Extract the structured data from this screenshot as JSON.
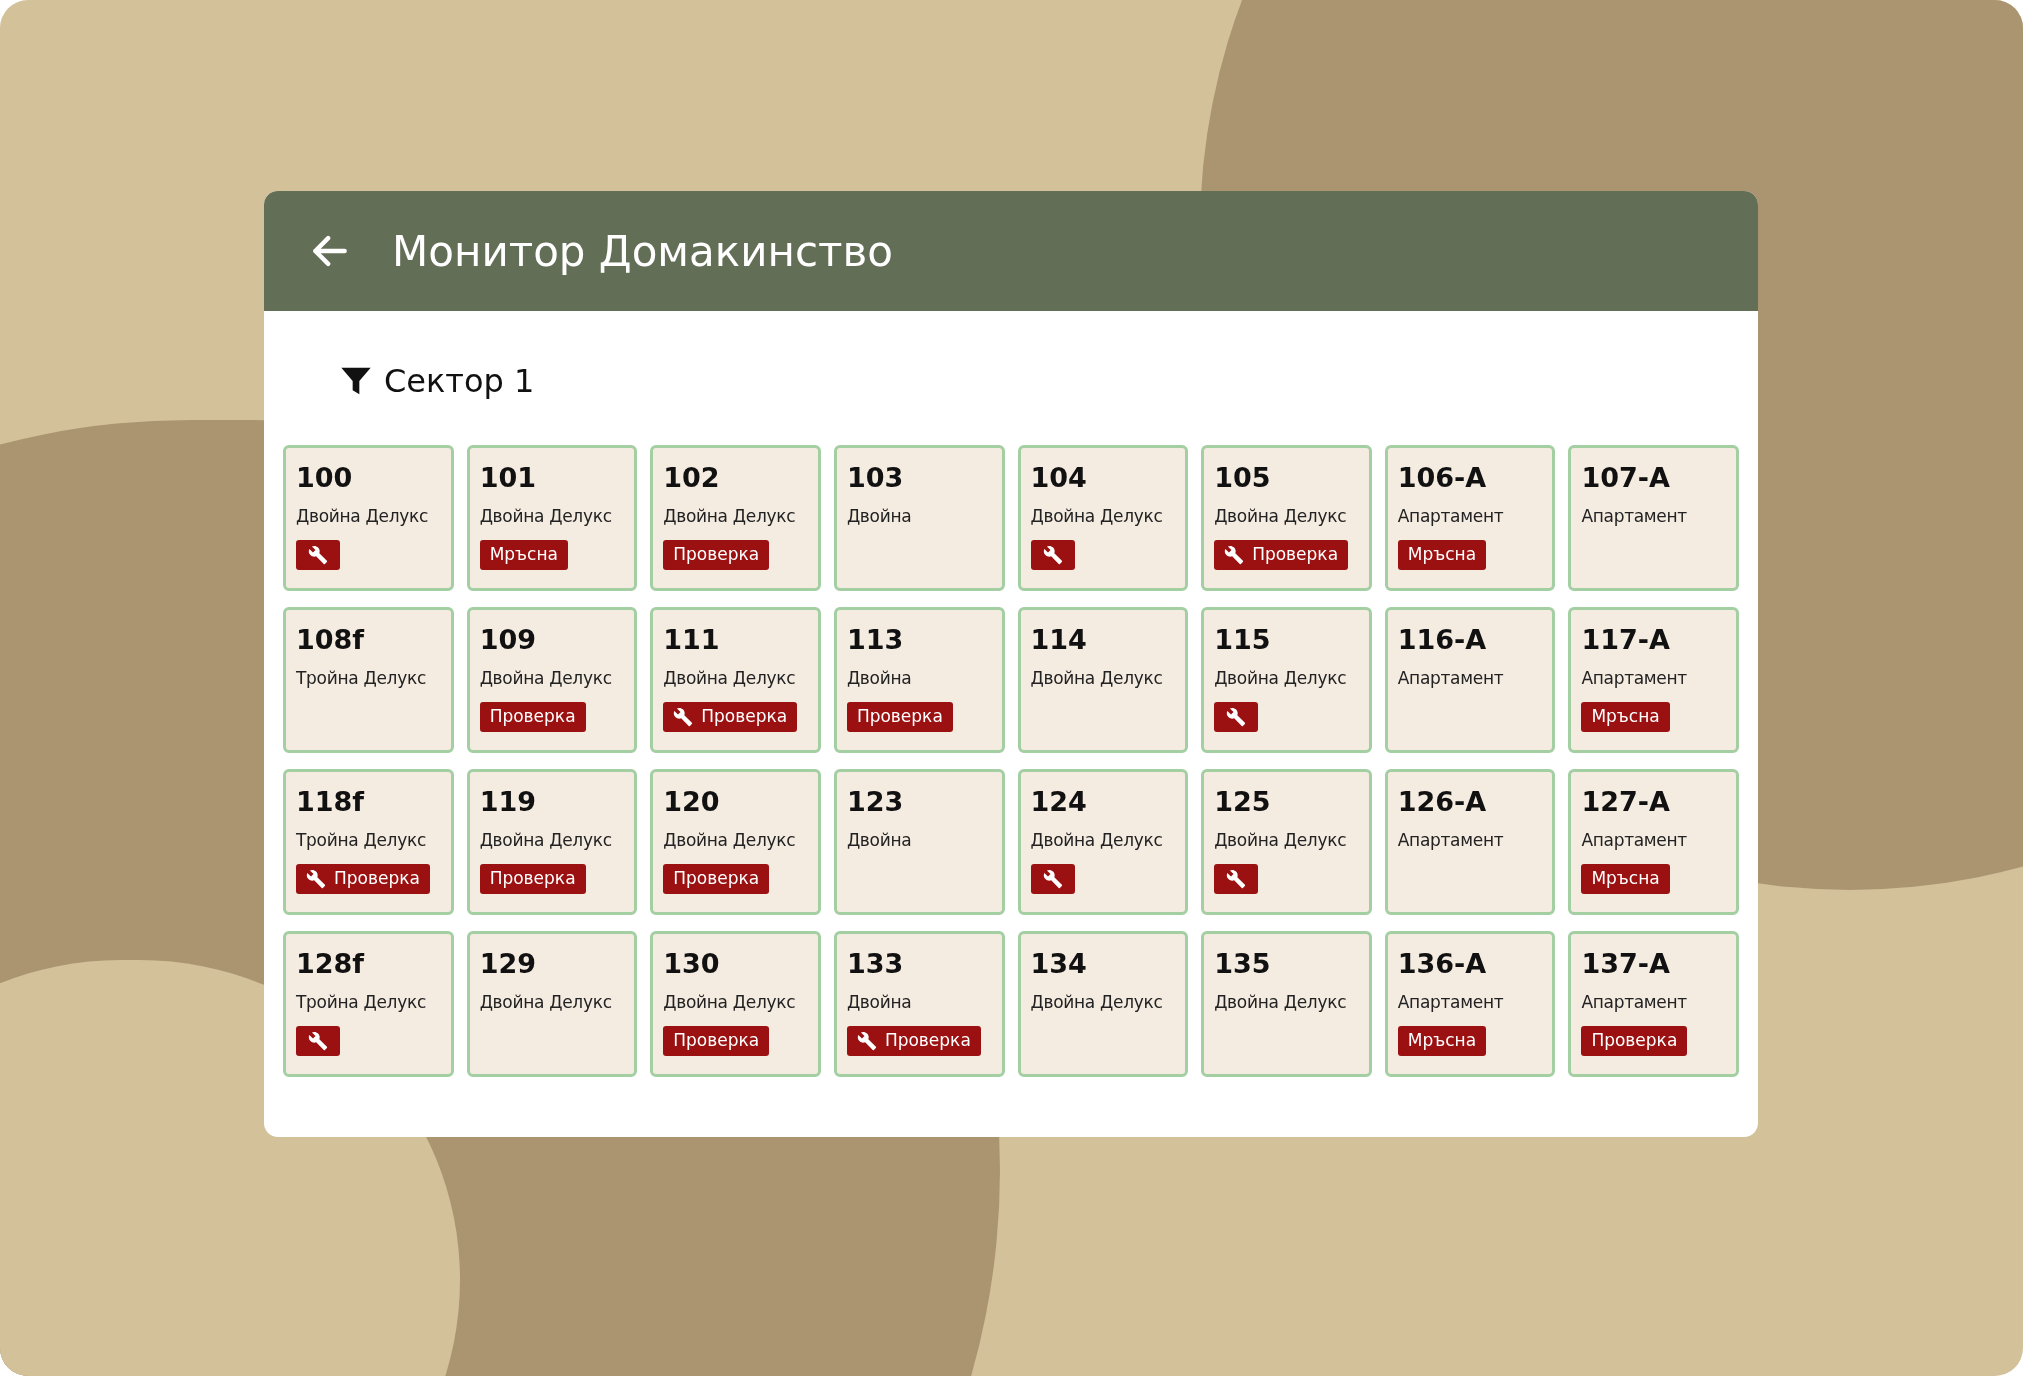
{
  "header": {
    "title": "Монитор Домакинство"
  },
  "filter": {
    "label": "Сектор 1"
  },
  "rooms": [
    {
      "number": "100",
      "type": "Двойна Делукс",
      "maintenance": true
    },
    {
      "number": "101",
      "type": "Двойна Делукс",
      "maintenance": false,
      "status": "Мръсна"
    },
    {
      "number": "102",
      "type": "Двойна Делукс",
      "maintenance": false,
      "status": "Проверка"
    },
    {
      "number": "103",
      "type": "Двойна",
      "maintenance": false
    },
    {
      "number": "104",
      "type": "Двойна Делукс",
      "maintenance": true
    },
    {
      "number": "105",
      "type": "Двойна Делукс",
      "maintenance": true,
      "status": "Проверка"
    },
    {
      "number": "106-A",
      "type": "Апартамент",
      "maintenance": false,
      "status": "Мръсна"
    },
    {
      "number": "107-A",
      "type": "Апартамент",
      "maintenance": false
    },
    {
      "number": "108f",
      "type": "Тройна Делукс",
      "maintenance": false
    },
    {
      "number": "109",
      "type": "Двойна Делукс",
      "maintenance": false,
      "status": "Проверка"
    },
    {
      "number": "111",
      "type": "Двойна Делукс",
      "maintenance": true,
      "status": "Проверка"
    },
    {
      "number": "113",
      "type": "Двойна",
      "maintenance": false,
      "status": "Проверка"
    },
    {
      "number": "114",
      "type": "Двойна Делукс",
      "maintenance": false
    },
    {
      "number": "115",
      "type": "Двойна Делукс",
      "maintenance": true
    },
    {
      "number": "116-A",
      "type": "Апартамент",
      "maintenance": false
    },
    {
      "number": "117-A",
      "type": "Апартамент",
      "maintenance": false,
      "status": "Мръсна"
    },
    {
      "number": "118f",
      "type": "Тройна Делукс",
      "maintenance": true,
      "status": "Проверка"
    },
    {
      "number": "119",
      "type": "Двойна Делукс",
      "maintenance": false,
      "status": "Проверка"
    },
    {
      "number": "120",
      "type": "Двойна Делукс",
      "maintenance": false,
      "status": "Проверка"
    },
    {
      "number": "123",
      "type": "Двойна",
      "maintenance": false
    },
    {
      "number": "124",
      "type": "Двойна Делукс",
      "maintenance": true
    },
    {
      "number": "125",
      "type": "Двойна Делукс",
      "maintenance": true
    },
    {
      "number": "126-A",
      "type": "Апартамент",
      "maintenance": false
    },
    {
      "number": "127-A",
      "type": "Апартамент",
      "maintenance": false,
      "status": "Мръсна"
    },
    {
      "number": "128f",
      "type": "Тройна Делукс",
      "maintenance": true
    },
    {
      "number": "129",
      "type": "Двойна Делукс",
      "maintenance": false
    },
    {
      "number": "130",
      "type": "Двойна Делукс",
      "maintenance": false,
      "status": "Проверка"
    },
    {
      "number": "133",
      "type": "Двойна",
      "maintenance": true,
      "status": "Проверка"
    },
    {
      "number": "134",
      "type": "Двойна Делукс",
      "maintenance": false
    },
    {
      "number": "135",
      "type": "Двойна Делукс",
      "maintenance": false
    },
    {
      "number": "136-A",
      "type": "Апартамент",
      "maintenance": false,
      "status": "Мръсна"
    },
    {
      "number": "137-A",
      "type": "Апартамент",
      "maintenance": false,
      "status": "Проверка"
    }
  ]
}
